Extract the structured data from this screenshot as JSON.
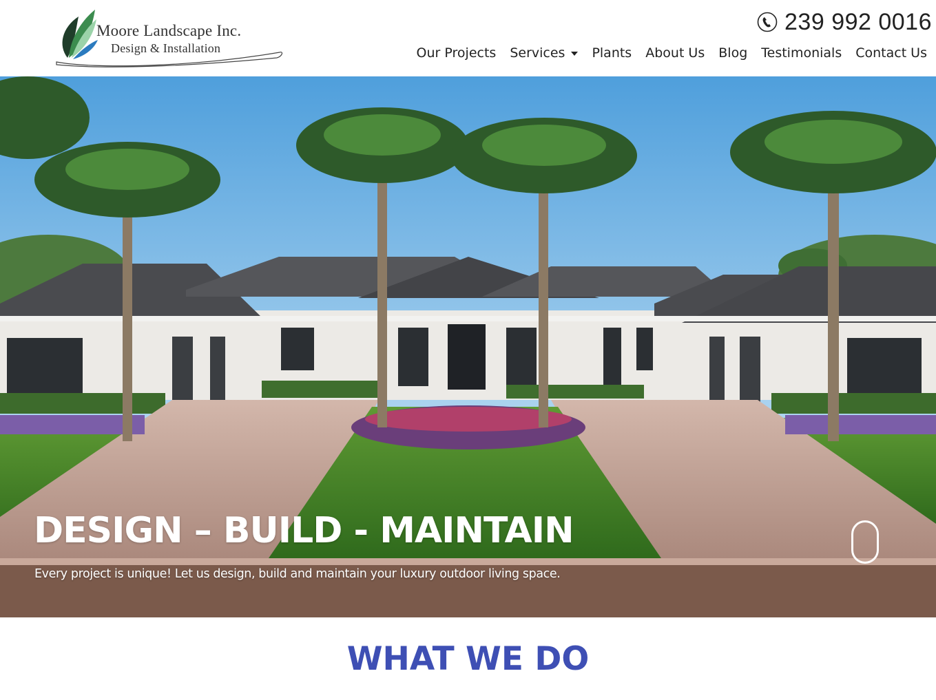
{
  "header": {
    "logo": {
      "line1": "Moore Landscape Inc.",
      "line2": "Design & Installation",
      "icon": "leaf-logo-icon",
      "colors": {
        "leaf_dark": "#1f3d2a",
        "leaf_light": "#9bd3a9",
        "leaf_blue": "#2b7bbf",
        "text": "#333333"
      }
    },
    "phone": {
      "icon": "phone-icon",
      "number": "239 992 0016"
    },
    "nav": [
      {
        "label": "Our Projects"
      },
      {
        "label": "Services",
        "has_dropdown": true
      },
      {
        "label": "Plants"
      },
      {
        "label": "About Us"
      },
      {
        "label": "Blog"
      },
      {
        "label": "Testimonials"
      },
      {
        "label": "Contact Us"
      }
    ]
  },
  "hero": {
    "title": "DESIGN – BUILD - MAINTAIN",
    "subtitle": "Every project is unique! Let us design, build and maintain your luxury outdoor living space.",
    "scroll_icon": "mouse-scroll-icon",
    "image": "luxury-home-palm-trees-driveway"
  },
  "section": {
    "title": "WHAT WE DO",
    "color": "#3e4fb4"
  }
}
